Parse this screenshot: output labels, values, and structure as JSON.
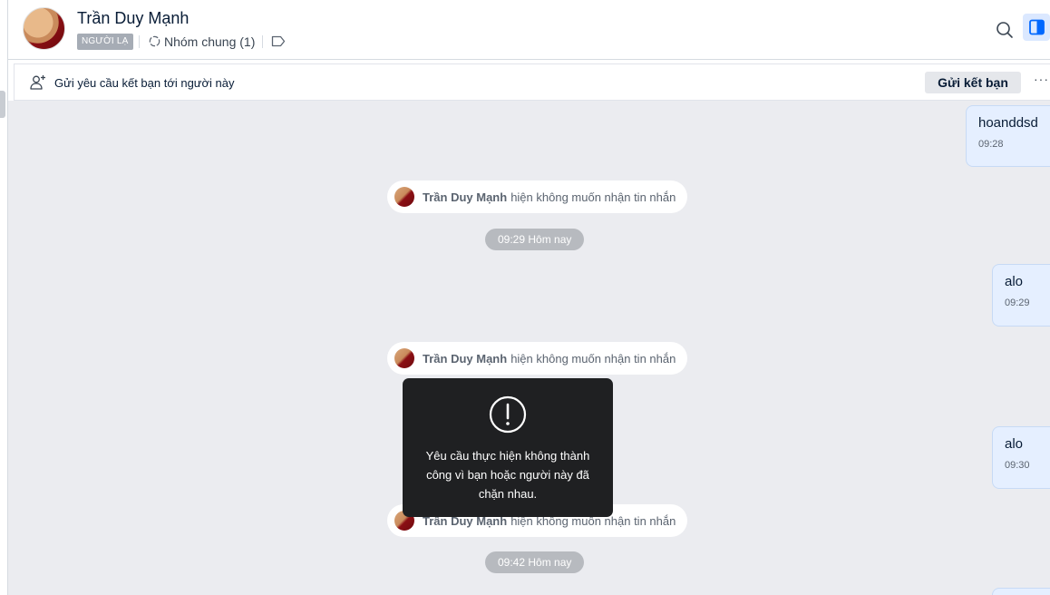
{
  "header": {
    "contact_name": "Trần Duy Mạnh",
    "stranger_tag": "NGƯỜI LẠ",
    "group_label": "Nhóm chung (1)"
  },
  "friend_request": {
    "text": "Gửi yêu cầu kết bạn tới người này",
    "button": "Gửi kết bạn",
    "more": "···"
  },
  "messages": [
    {
      "text": "hoanddsd",
      "time": "09:28"
    },
    {
      "text": "alo",
      "time": "09:29"
    },
    {
      "text": "alo",
      "time": "09:30"
    }
  ],
  "system_notices": [
    {
      "name": "Trần Duy Mạnh",
      "msg": "hiện không muốn nhận tin nhắn"
    },
    {
      "name": "Trần Duy Mạnh",
      "msg": "hiện không muốn nhận tin nhắn"
    },
    {
      "name": "Trần Duy Mạnh",
      "msg": "hiện không muốn nhận tin nhắn"
    }
  ],
  "time_separators": [
    "09:29 Hôm nay",
    "09:42 Hôm nay"
  ],
  "toast": {
    "text": "Yêu cầu thực hiện không thành công vì bạn hoặc người này đã chặn nhau."
  },
  "colors": {
    "accent": "#0068ff",
    "chat_bg": "#ebecf0",
    "bubble_bg": "#e5efff",
    "toast_bg": "#1f2022"
  },
  "icons": [
    "search-icon",
    "side-panel-icon",
    "group-icon",
    "tag-icon",
    "add-friend-icon",
    "warning-icon"
  ]
}
